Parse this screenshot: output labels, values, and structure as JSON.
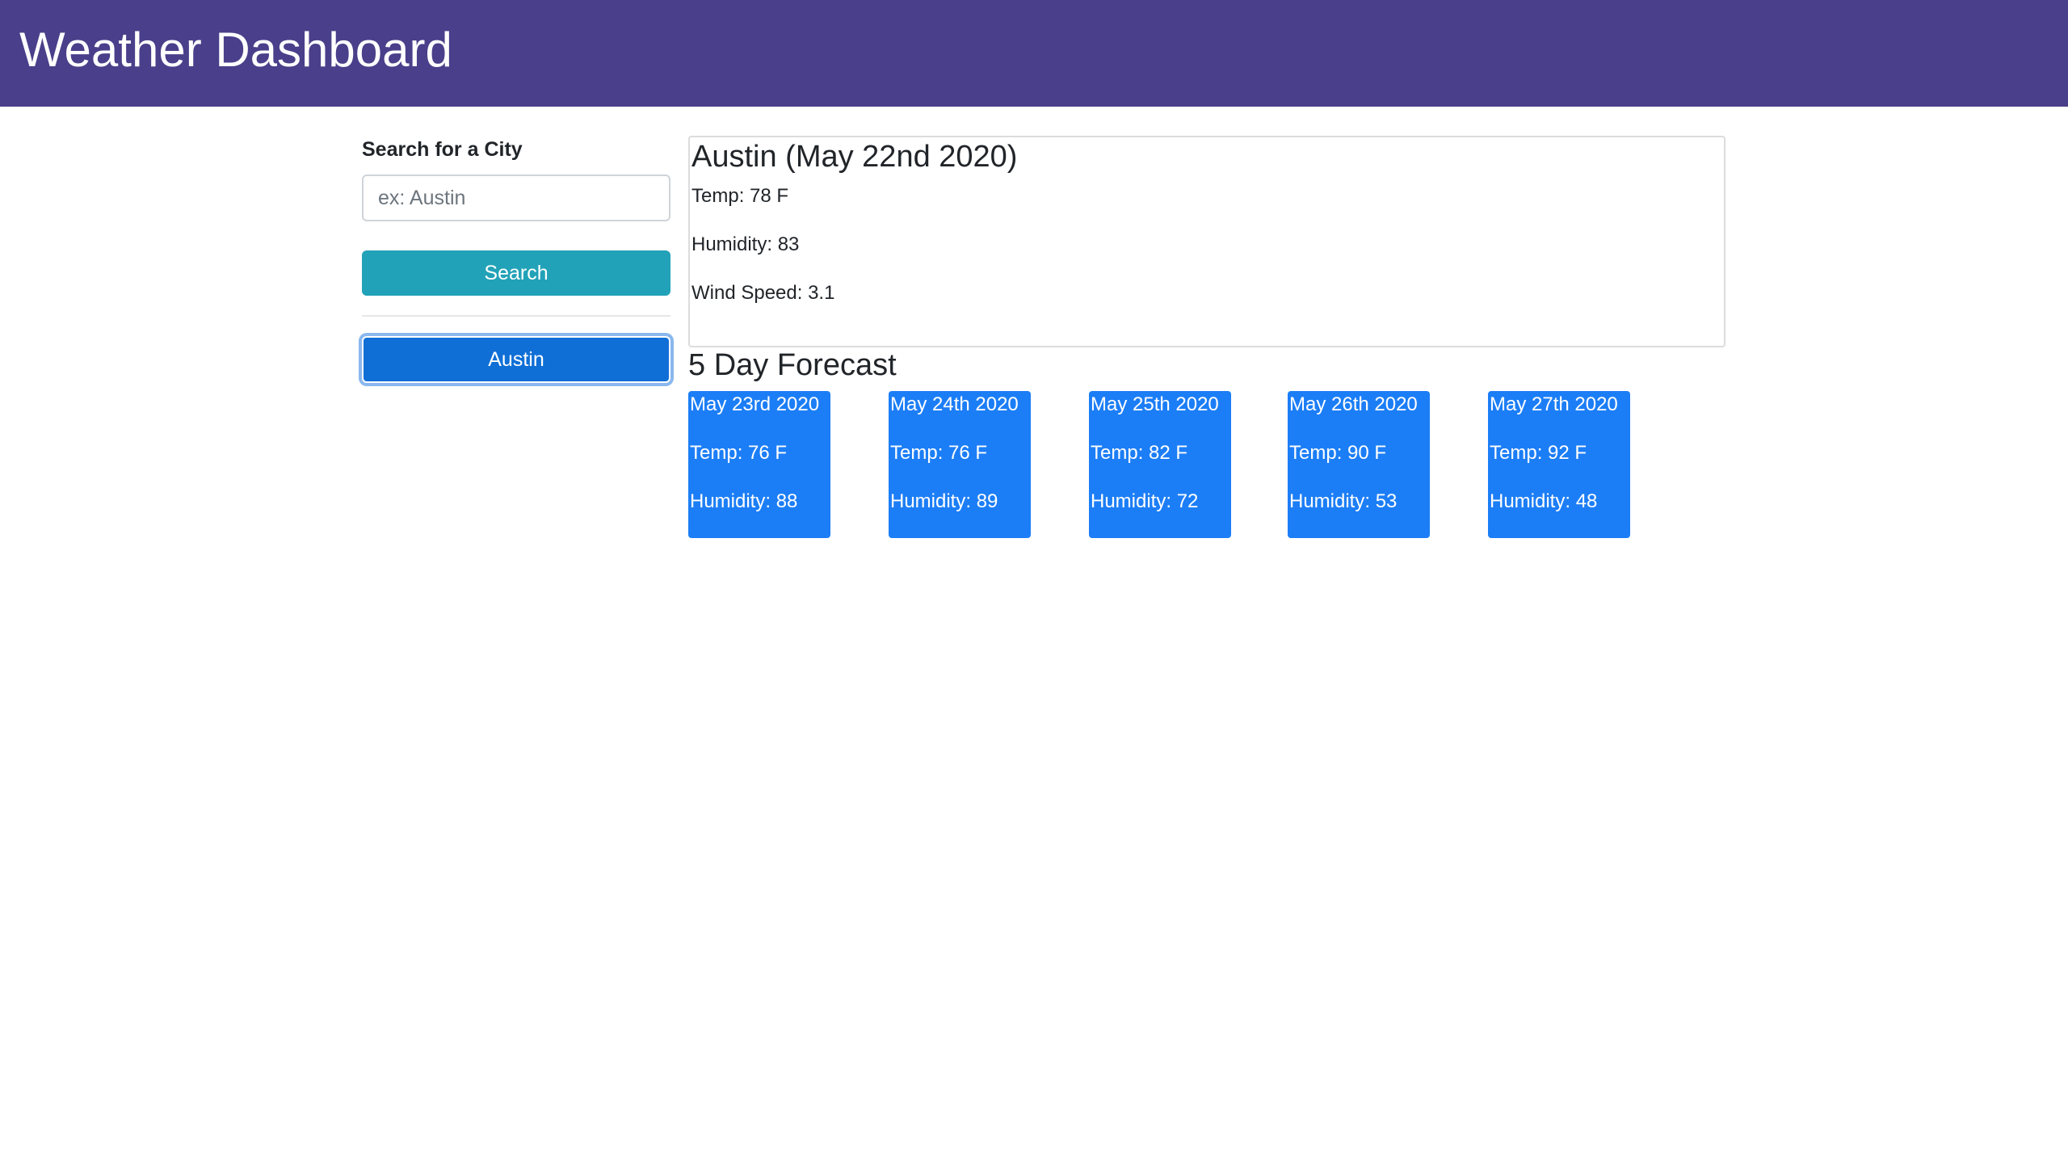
{
  "header": {
    "title": "Weather Dashboard"
  },
  "sidebar": {
    "search_label": "Search for a City",
    "search_placeholder": "ex: Austin",
    "search_value": "",
    "search_button_label": "Search",
    "history": [
      "Austin"
    ]
  },
  "current": {
    "title": "Austin (May 22nd 2020)",
    "temp": "Temp: 78 F",
    "humidity": "Humidity: 83",
    "wind": "Wind Speed: 3.1"
  },
  "forecast": {
    "title": "5 Day Forecast",
    "days": [
      {
        "date": "May 23rd 2020",
        "temp": "Temp: 76 F",
        "humidity": "Humidity: 88"
      },
      {
        "date": "May 24th 2020",
        "temp": "Temp: 76 F",
        "humidity": "Humidity: 89"
      },
      {
        "date": "May 25th 2020",
        "temp": "Temp: 82 F",
        "humidity": "Humidity: 72"
      },
      {
        "date": "May 26th 2020",
        "temp": "Temp: 90 F",
        "humidity": "Humidity: 53"
      },
      {
        "date": "May 27th 2020",
        "temp": "Temp: 92 F",
        "humidity": "Humidity: 48"
      }
    ]
  },
  "colors": {
    "navbar": "#4a3f8a",
    "search_button": "#22a2b8",
    "history_button": "#0f6fd6",
    "forecast_card": "#1c7ef6"
  }
}
